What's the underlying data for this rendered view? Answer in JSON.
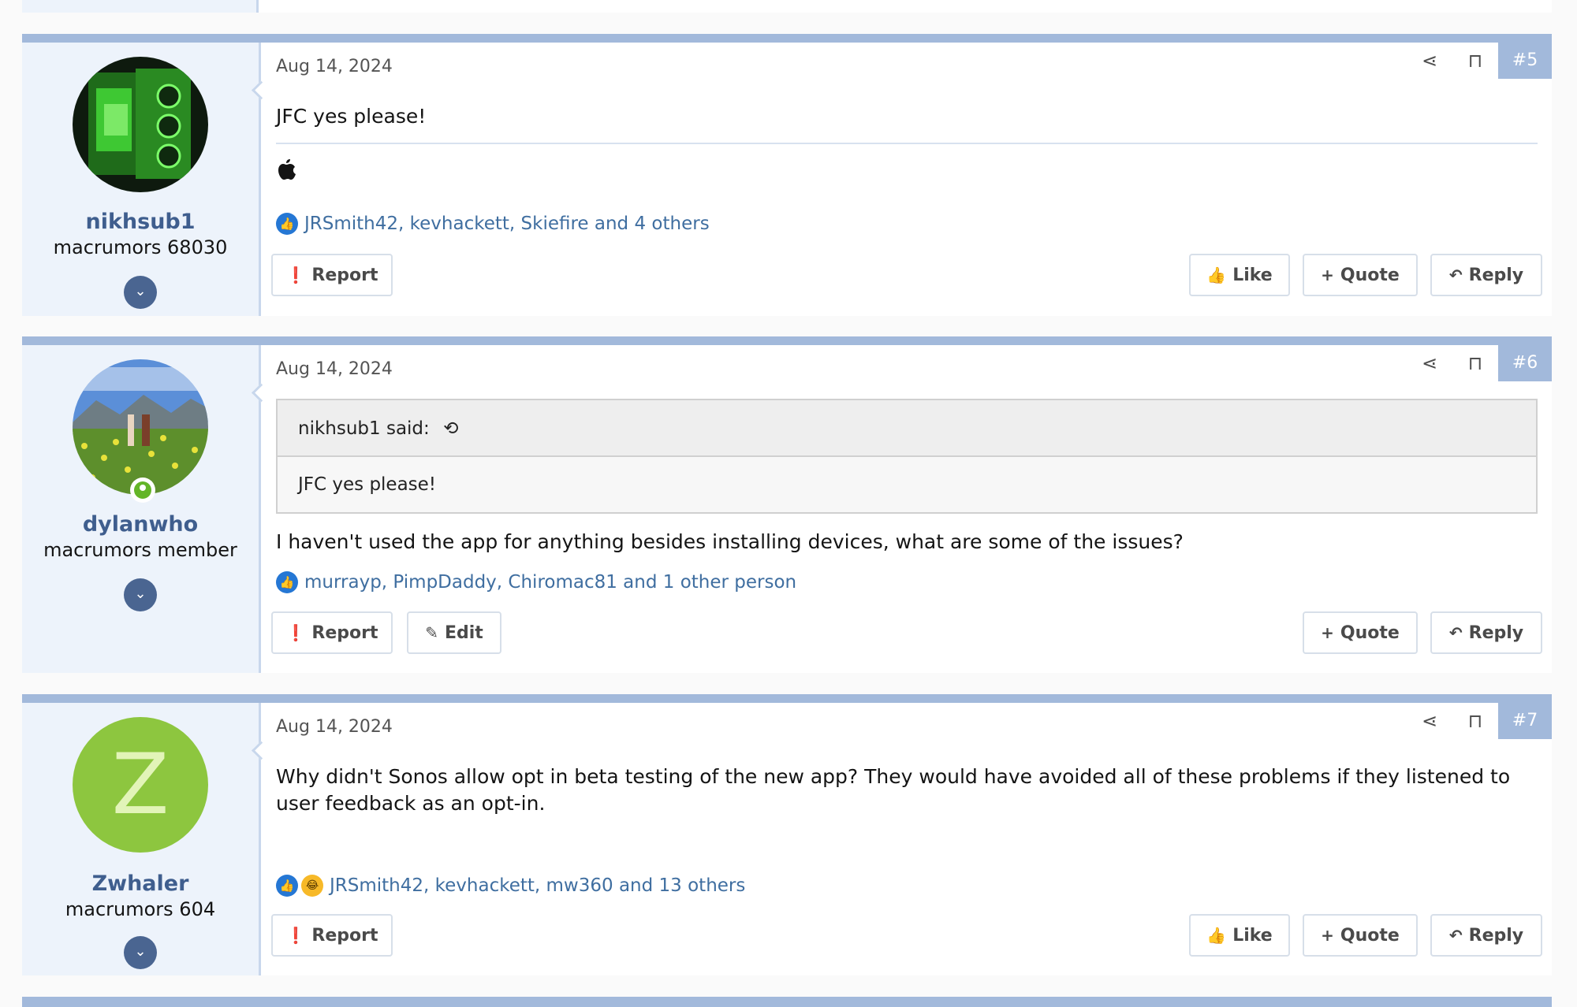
{
  "posts": [
    {
      "number": "#5",
      "date": "Aug 14, 2024",
      "username": "nikhsub1",
      "usertitle": "macrumors 68030",
      "avatar": "green-lit-pc-case-photo",
      "body": "JFC yes please!",
      "signature_icon": "apple-logo-icon",
      "reactions": {
        "icons": [
          "like-icon"
        ],
        "text": "JRSmith42, kevhackett, Skiefire and 4 others"
      },
      "buttons": {
        "report": "Report",
        "like": "Like",
        "quote": "Quote",
        "reply": "Reply"
      }
    },
    {
      "number": "#6",
      "date": "Aug 14, 2024",
      "username": "dylanwho",
      "usertitle": "macrumors member",
      "avatar": "couple-in-flower-field-photo",
      "online": true,
      "quote": {
        "author": "nikhsub1 said:",
        "text": "JFC yes please!"
      },
      "body": "I haven't used the app for anything besides installing devices, what are some of the issues?",
      "reactions": {
        "icons": [
          "like-icon"
        ],
        "text": "murrayp, PimpDaddy, Chiromac81 and 1 other person"
      },
      "buttons": {
        "report": "Report",
        "edit": "Edit",
        "quote": "Quote",
        "reply": "Reply"
      }
    },
    {
      "number": "#7",
      "date": "Aug 14, 2024",
      "username": "Zwhaler",
      "usertitle": "macrumors 604",
      "avatar_letter": "Z",
      "avatar_color": "#8dc63f",
      "body": "Why didn't Sonos allow opt in beta testing of the new app? They would have avoided all of these problems if they listened to user feedback as an opt-in.",
      "reactions": {
        "icons": [
          "like-icon",
          "haha-icon"
        ],
        "text": "JRSmith42, kevhackett, mw360 and 13 others"
      },
      "buttons": {
        "report": "Report",
        "like": "Like",
        "quote": "Quote",
        "reply": "Reply"
      }
    }
  ],
  "colors": {
    "accent": "#a2b9db",
    "username": "#3f5e8e",
    "link": "#3f6ea0",
    "sidebar": "#edf3fb"
  }
}
